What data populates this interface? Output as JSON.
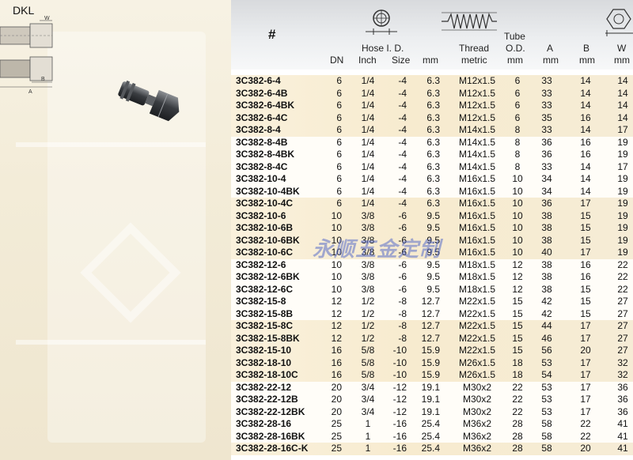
{
  "title": "DKL",
  "drawing_labels": {
    "w": "W",
    "b": "B",
    "a": "A"
  },
  "header": {
    "part": "#",
    "dn": "DN",
    "hose_id": "Hose I. D.",
    "inch": "Inch",
    "size": "Size",
    "mm": "mm",
    "thread": "Thread",
    "thread_sub": "metric",
    "tube": "Tube",
    "tube_sub": "O.D.",
    "tube_unit": "mm",
    "a": "A",
    "a_unit": "mm",
    "b": "B",
    "b_unit": "mm",
    "w": "W",
    "w_unit": "mm"
  },
  "watermark": "永顺五金定制",
  "groups": [
    {
      "shade": "shaded",
      "rows": [
        [
          "3C382-6-4",
          "6",
          "1/4",
          "-4",
          "6.3",
          "M12x1.5",
          "6",
          "33",
          "14",
          "14"
        ],
        [
          "3C382-6-4B",
          "6",
          "1/4",
          "-4",
          "6.3",
          "M12x1.5",
          "6",
          "33",
          "14",
          "14"
        ],
        [
          "3C382-6-4BK",
          "6",
          "1/4",
          "-4",
          "6.3",
          "M12x1.5",
          "6",
          "33",
          "14",
          "14"
        ],
        [
          "3C382-6-4C",
          "6",
          "1/4",
          "-4",
          "6.3",
          "M12x1.5",
          "6",
          "35",
          "16",
          "14"
        ],
        [
          "3C382-8-4",
          "6",
          "1/4",
          "-4",
          "6.3",
          "M14x1.5",
          "8",
          "33",
          "14",
          "17"
        ]
      ]
    },
    {
      "shade": "white",
      "rows": [
        [
          "3C382-8-4B",
          "6",
          "1/4",
          "-4",
          "6.3",
          "M14x1.5",
          "8",
          "36",
          "16",
          "19"
        ],
        [
          "3C382-8-4BK",
          "6",
          "1/4",
          "-4",
          "6.3",
          "M14x1.5",
          "8",
          "36",
          "16",
          "19"
        ],
        [
          "3C382-8-4C",
          "6",
          "1/4",
          "-4",
          "6.3",
          "M14x1.5",
          "8",
          "33",
          "14",
          "17"
        ],
        [
          "3C382-10-4",
          "6",
          "1/4",
          "-4",
          "6.3",
          "M16x1.5",
          "10",
          "34",
          "14",
          "19"
        ],
        [
          "3C382-10-4BK",
          "6",
          "1/4",
          "-4",
          "6.3",
          "M16x1.5",
          "10",
          "34",
          "14",
          "19"
        ]
      ]
    },
    {
      "shade": "shaded",
      "rows": [
        [
          "3C382-10-4C",
          "6",
          "1/4",
          "-4",
          "6.3",
          "M16x1.5",
          "10",
          "36",
          "17",
          "19"
        ],
        [
          "3C382-10-6",
          "10",
          "3/8",
          "-6",
          "9.5",
          "M16x1.5",
          "10",
          "38",
          "15",
          "19"
        ],
        [
          "3C382-10-6B",
          "10",
          "3/8",
          "-6",
          "9.5",
          "M16x1.5",
          "10",
          "38",
          "15",
          "19"
        ],
        [
          "3C382-10-6BK",
          "10",
          "3/8",
          "-6",
          "9.5",
          "M16x1.5",
          "10",
          "38",
          "15",
          "19"
        ],
        [
          "3C382-10-6C",
          "10",
          "3/8",
          "-6",
          "9.5",
          "M16x1.5",
          "10",
          "40",
          "17",
          "19"
        ]
      ]
    },
    {
      "shade": "white",
      "rows": [
        [
          "3C382-12-6",
          "10",
          "3/8",
          "-6",
          "9.5",
          "M18x1.5",
          "12",
          "38",
          "16",
          "22"
        ],
        [
          "3C382-12-6BK",
          "10",
          "3/8",
          "-6",
          "9.5",
          "M18x1.5",
          "12",
          "38",
          "16",
          "22"
        ],
        [
          "3C382-12-6C",
          "10",
          "3/8",
          "-6",
          "9.5",
          "M18x1.5",
          "12",
          "38",
          "15",
          "22"
        ],
        [
          "3C382-15-8",
          "12",
          "1/2",
          "-8",
          "12.7",
          "M22x1.5",
          "15",
          "42",
          "15",
          "27"
        ],
        [
          "3C382-15-8B",
          "12",
          "1/2",
          "-8",
          "12.7",
          "M22x1.5",
          "15",
          "42",
          "15",
          "27"
        ]
      ]
    },
    {
      "shade": "shaded",
      "rows": [
        [
          "3C382-15-8C",
          "12",
          "1/2",
          "-8",
          "12.7",
          "M22x1.5",
          "15",
          "44",
          "17",
          "27"
        ],
        [
          "3C382-15-8BK",
          "12",
          "1/2",
          "-8",
          "12.7",
          "M22x1.5",
          "15",
          "46",
          "17",
          "27"
        ],
        [
          "3C382-15-10",
          "16",
          "5/8",
          "-10",
          "15.9",
          "M22x1.5",
          "15",
          "56",
          "20",
          "27"
        ],
        [
          "3C382-18-10",
          "16",
          "5/8",
          "-10",
          "15.9",
          "M26x1.5",
          "18",
          "53",
          "17",
          "32"
        ],
        [
          "3C382-18-10C",
          "16",
          "5/8",
          "-10",
          "15.9",
          "M26x1.5",
          "18",
          "54",
          "17",
          "32"
        ]
      ]
    },
    {
      "shade": "white",
      "rows": [
        [
          "3C382-22-12",
          "20",
          "3/4",
          "-12",
          "19.1",
          "M30x2",
          "22",
          "53",
          "17",
          "36"
        ],
        [
          "3C382-22-12B",
          "20",
          "3/4",
          "-12",
          "19.1",
          "M30x2",
          "22",
          "53",
          "17",
          "36"
        ],
        [
          "3C382-22-12BK",
          "20",
          "3/4",
          "-12",
          "19.1",
          "M30x2",
          "22",
          "53",
          "17",
          "36"
        ],
        [
          "3C382-28-16",
          "25",
          "1",
          "-16",
          "25.4",
          "M36x2",
          "28",
          "58",
          "22",
          "41"
        ],
        [
          "3C382-28-16BK",
          "25",
          "1",
          "-16",
          "25.4",
          "M36x2",
          "28",
          "58",
          "22",
          "41"
        ]
      ]
    },
    {
      "shade": "shaded",
      "rows": [
        [
          "3C382-28-16C-K",
          "25",
          "1",
          "-16",
          "25.4",
          "M36x2",
          "28",
          "58",
          "20",
          "41"
        ]
      ]
    }
  ]
}
